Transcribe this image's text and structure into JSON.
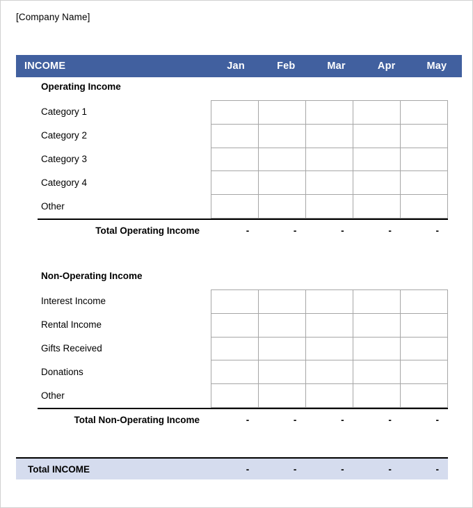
{
  "document": {
    "company_name": "[Company Name]"
  },
  "header": {
    "title": "INCOME",
    "months": [
      "Jan",
      "Feb",
      "Mar",
      "Apr",
      "May"
    ],
    "band_color": "#41609f",
    "text_color": "#ffffff"
  },
  "sections": [
    {
      "id": "operating",
      "title": "Operating Income",
      "rows": [
        {
          "label": "Category 1",
          "values": [
            "",
            "",
            "",
            "",
            ""
          ]
        },
        {
          "label": "Category 2",
          "values": [
            "",
            "",
            "",
            "",
            ""
          ]
        },
        {
          "label": "Category 3",
          "values": [
            "",
            "",
            "",
            "",
            ""
          ]
        },
        {
          "label": "Category 4",
          "values": [
            "",
            "",
            "",
            "",
            ""
          ]
        },
        {
          "label": "Other",
          "values": [
            "",
            "",
            "",
            "",
            ""
          ]
        }
      ],
      "total": {
        "label": "Total Operating Income",
        "values": [
          "-",
          "-",
          "-",
          "-",
          "-"
        ]
      }
    },
    {
      "id": "nonoperating",
      "title": "Non-Operating Income",
      "rows": [
        {
          "label": "Interest Income",
          "values": [
            "",
            "",
            "",
            "",
            ""
          ]
        },
        {
          "label": "Rental Income",
          "values": [
            "",
            "",
            "",
            "",
            ""
          ]
        },
        {
          "label": "Gifts Received",
          "values": [
            "",
            "",
            "",
            "",
            ""
          ]
        },
        {
          "label": "Donations",
          "values": [
            "",
            "",
            "",
            "",
            ""
          ]
        },
        {
          "label": "Other",
          "values": [
            "",
            "",
            "",
            "",
            ""
          ]
        }
      ],
      "total": {
        "label": "Total Non-Operating Income",
        "values": [
          "-",
          "-",
          "-",
          "-",
          "-"
        ]
      }
    }
  ],
  "grand_total": {
    "label": "Total INCOME",
    "values": [
      "-",
      "-",
      "-",
      "-",
      "-"
    ],
    "background_color": "#d5dcee"
  }
}
